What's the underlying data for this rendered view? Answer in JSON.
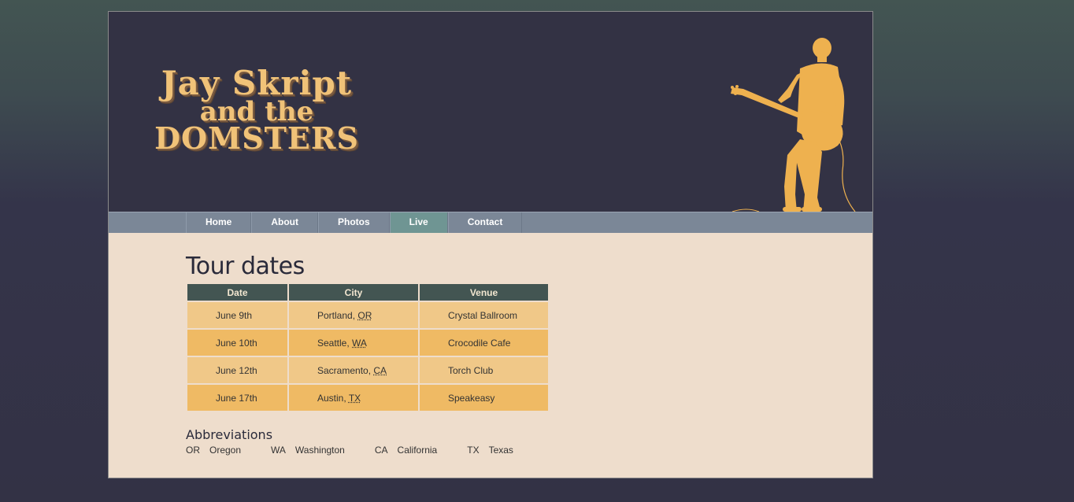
{
  "logo": {
    "line1": "Jay Skript",
    "line2": "and the",
    "line3": "DOMSTERS",
    "color": "#f0c278"
  },
  "nav": {
    "items": [
      "Home",
      "About",
      "Photos",
      "Live",
      "Contact"
    ],
    "active": "Live"
  },
  "main": {
    "title": "Tour dates",
    "table": {
      "headers": [
        "Date",
        "City",
        "Venue"
      ],
      "rows": [
        {
          "date": "June 9th",
          "city": "Portland, ",
          "state": "OR",
          "venue": "Crystal Ballroom"
        },
        {
          "date": "June 10th",
          "city": "Seattle, ",
          "state": "WA",
          "venue": "Crocodile Cafe"
        },
        {
          "date": "June 12th",
          "city": "Sacramento, ",
          "state": "CA",
          "venue": "Torch Club"
        },
        {
          "date": "June 17th",
          "city": "Austin, ",
          "state": "TX",
          "venue": "Speakeasy"
        }
      ]
    },
    "abbreviations": {
      "title": "Abbreviations",
      "items": [
        {
          "term": "OR",
          "def": "Oregon"
        },
        {
          "term": "WA",
          "def": "Washington"
        },
        {
          "term": "CA",
          "def": "California"
        },
        {
          "term": "TX",
          "def": "Texas"
        }
      ]
    }
  },
  "colors": {
    "banner": "#333244",
    "nav": "#7b8797",
    "nav_active": "#6f9593",
    "content_bg": "#eeddcc",
    "table_header": "#435552",
    "row_light": "#f0c888",
    "row_dark": "#efba64",
    "accent": "#eeb14f"
  }
}
